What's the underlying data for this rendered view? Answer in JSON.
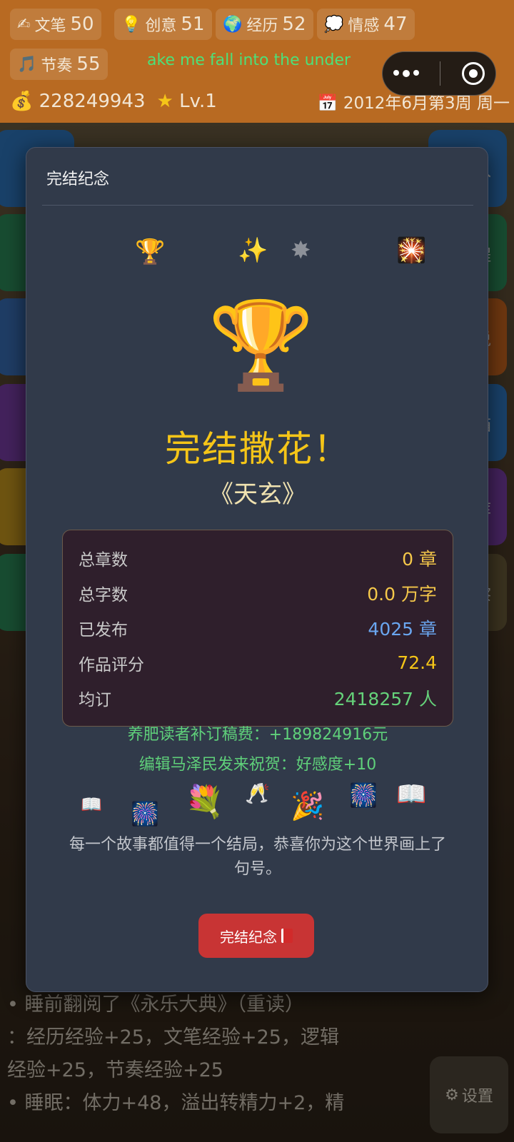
{
  "stats": [
    {
      "icon": "✍",
      "label": "文笔",
      "value": "50"
    },
    {
      "icon": "💡",
      "label": "创意",
      "value": "51"
    },
    {
      "icon": "🌍",
      "label": "经历",
      "value": "52"
    },
    {
      "icon": "💭",
      "label": "情感",
      "value": "47"
    },
    {
      "icon": "🎵",
      "label": "节奏",
      "value": "55"
    }
  ],
  "marquee": "ake me fall into the under",
  "money": "228249943",
  "level": "Lv.1",
  "date": "2012年6月第3周 周一",
  "side_right_labels": [
    "入",
    "程",
    "说",
    "箱",
    "库",
    "察"
  ],
  "log_lines": [
    "•  睡前翻阅了《永乐大典》（重读）",
    "：经历经验+25，文笔经验+25，逻辑",
    "经验+25，节奏经验+25",
    "•  睡眠：体力+48，溢出转精力+2，精"
  ],
  "settings_label": "设置",
  "modal": {
    "title": "完结纪念",
    "headline": "完结撒花！",
    "book_title": "《天玄》",
    "rows": [
      {
        "label": "总章数",
        "value": "0 章",
        "color": "c-yellow"
      },
      {
        "label": "总字数",
        "value": "0.0 万字",
        "color": "c-yellow"
      },
      {
        "label": "已发布",
        "value": "4025 章",
        "color": "c-blue"
      },
      {
        "label": "作品评分",
        "value": "72.4",
        "color": "c-gold"
      },
      {
        "label": "均订",
        "value": "2418257 人",
        "color": "c-green"
      }
    ],
    "reward_1": "养肥读者补订稿费：+189824916元",
    "reward_2": "编辑马泽民发来祝贺：好感度+10",
    "blessing": "每一个故事都值得一个结局，恭喜你为这个世界画上了句号。",
    "button_label": "完结纪念"
  }
}
